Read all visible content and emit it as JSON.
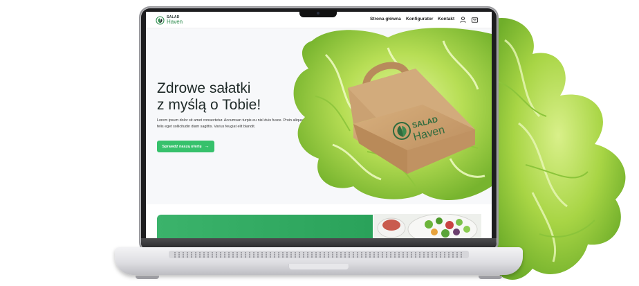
{
  "brand": {
    "line1": "SALAD",
    "line2": "Haven"
  },
  "nav": {
    "items": [
      "Strona główna",
      "Konfigurator",
      "Kontakt"
    ]
  },
  "icons": {
    "user": "user-icon",
    "cart": "cart-icon",
    "arrow": "arrow-right-icon"
  },
  "hero": {
    "title_line1": "Zdrowe sałatki",
    "title_line2": "z myślą o Tobie!",
    "subtitle": "Lorem ipsum dolor sit amet consectetur. Accumsan turpis eu nisl duis fusce. Proin aliquam felis eget sollicitudin diam sagittis. Varius feugiat elit blandit.",
    "cta_label": "Sprawdź naszą ofertę",
    "box_brand_line1": "SALAD",
    "box_brand_line2": "Haven"
  },
  "colors": {
    "accent": "#36c16b",
    "brand_dark": "#1f2d2a",
    "brand_green": "#2e8c4d",
    "banner": "#3bb36b",
    "kraft": "#c99d6b"
  }
}
